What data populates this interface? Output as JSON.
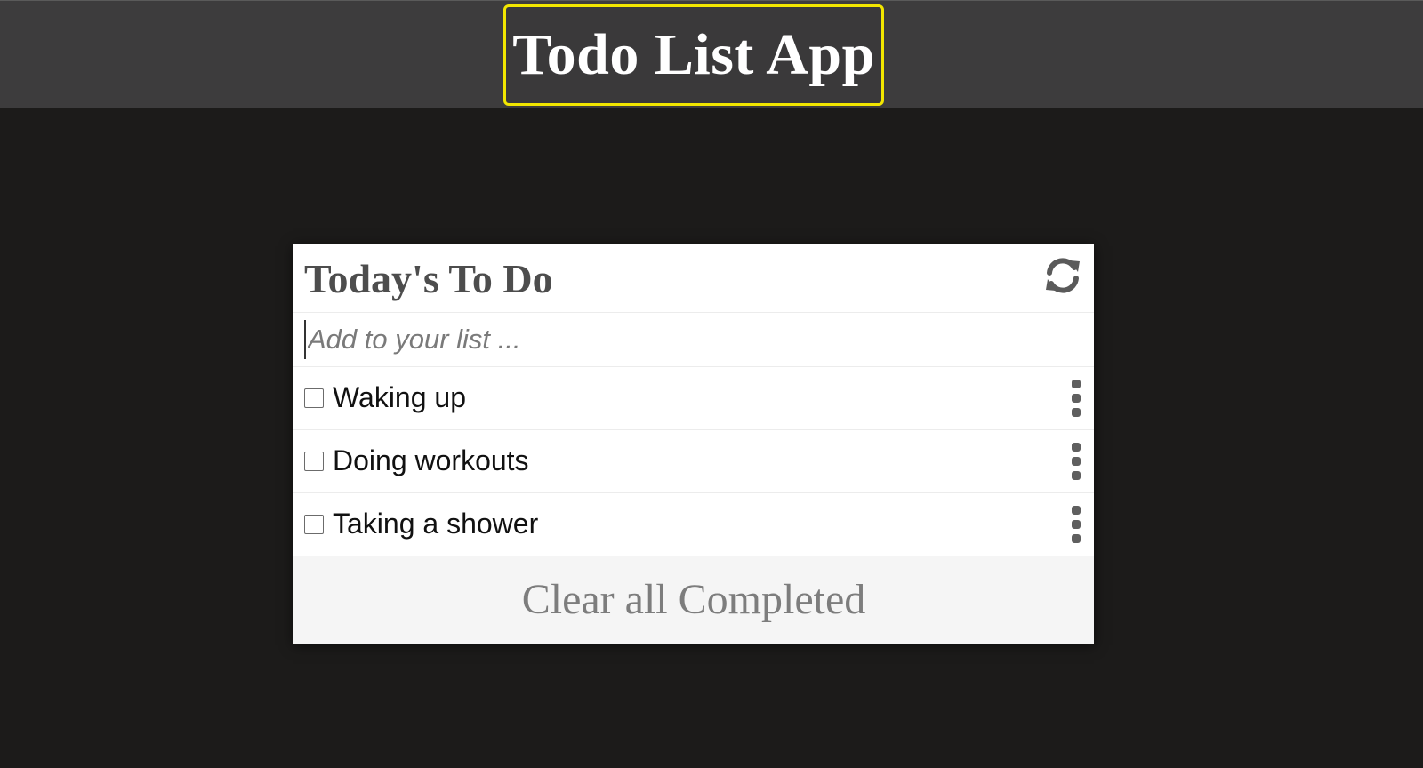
{
  "header": {
    "app_title": "Todo List App",
    "title_border_color": "#f2e600"
  },
  "card": {
    "title": "Today's To Do",
    "refresh_icon": "refresh-icon",
    "add_input": {
      "placeholder": "Add to your list ...",
      "value": ""
    },
    "items": [
      {
        "text": "Waking up",
        "checked": false,
        "menu_icon": "kebab-menu-icon"
      },
      {
        "text": "Doing workouts",
        "checked": false,
        "menu_icon": "kebab-menu-icon"
      },
      {
        "text": "Taking a shower",
        "checked": false,
        "menu_icon": "kebab-menu-icon"
      }
    ],
    "clear_button_label": "Clear all Completed"
  }
}
